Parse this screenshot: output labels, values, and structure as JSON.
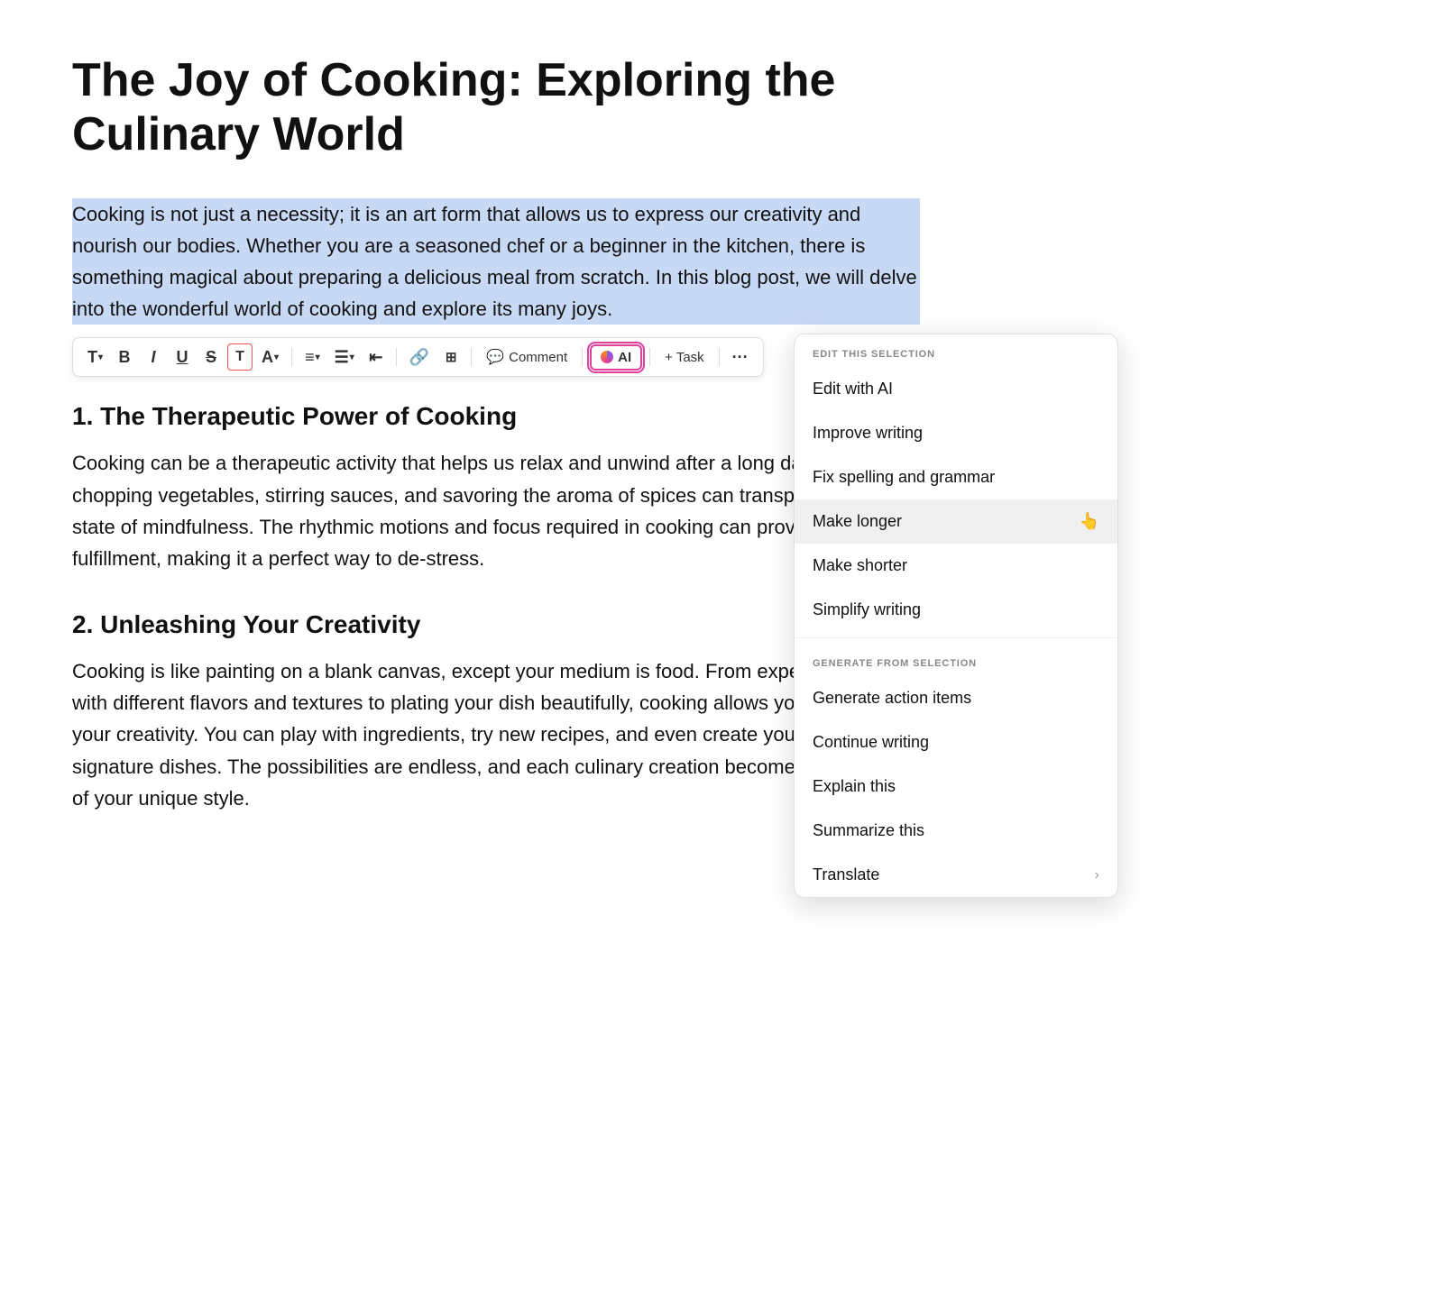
{
  "document": {
    "title": "The Joy of Cooking: Exploring the Culinary World",
    "selected_paragraph": "Cooking is not just a necessity; it is an art form that allows us to express our creativity and nourish our bodies. Whether you are a seasoned chef or a beginner in the kitchen, there is something magical about preparing a delicious meal from scratch. In this blog post, we will delve into the wonderful world of cooking and explore its many joys.",
    "section1_heading": "1. The Therapeutic Power of Cooking",
    "section1_text": "Cooking can be a therapeutic activity that helps us relax and unwind after a long day. The act of chopping vegetables, stirring sauces, and savoring the aroma of spices can transport us to a state of mindfulness. The rhythmic motions and focus required in cooking can provide a sense of fulfillment, making it a perfect way to de-stress.",
    "section2_heading": "2. Unleashing Your Creativity",
    "section2_text": "Cooking is like painting on a blank canvas, except your medium is food. From experimenting with different flavors and textures to plating your dish beautifully, cooking allows you to express your creativity. You can play with ingredients, try new recipes, and even create your own signature dishes. The possibilities are endless, and each culinary creation becomes a reflection of your unique style."
  },
  "toolbar": {
    "text_label": "T",
    "bold_label": "B",
    "italic_label": "I",
    "underline_label": "U",
    "strikethrough_label": "S",
    "highlight_label": "T",
    "font_color_label": "A",
    "align_label": "≡",
    "list_label": "≡",
    "outdent_label": "⇤",
    "link_label": "🔗",
    "table_label": "⊞",
    "comment_label": "Comment",
    "ai_label": "AI",
    "task_label": "+ Task",
    "more_label": "···"
  },
  "dropdown": {
    "edit_section_label": "EDIT THIS SELECTION",
    "generate_section_label": "GENERATE FROM SELECTION",
    "items_edit": [
      {
        "id": "edit-with-ai",
        "label": "Edit with AI",
        "has_arrow": false
      },
      {
        "id": "improve-writing",
        "label": "Improve writing",
        "has_arrow": false
      },
      {
        "id": "fix-spelling-grammar",
        "label": "Fix spelling and grammar",
        "has_arrow": false
      },
      {
        "id": "make-longer",
        "label": "Make longer",
        "has_arrow": false,
        "hovered": true
      },
      {
        "id": "make-shorter",
        "label": "Make shorter",
        "has_arrow": false
      },
      {
        "id": "simplify-writing",
        "label": "Simplify writing",
        "has_arrow": false
      }
    ],
    "items_generate": [
      {
        "id": "generate-action-items",
        "label": "Generate action items",
        "has_arrow": false
      },
      {
        "id": "continue-writing",
        "label": "Continue writing",
        "has_arrow": false
      },
      {
        "id": "explain-this",
        "label": "Explain this",
        "has_arrow": false
      },
      {
        "id": "summarize-this",
        "label": "Summarize this",
        "has_arrow": false
      },
      {
        "id": "translate",
        "label": "Translate",
        "has_arrow": true
      }
    ]
  }
}
